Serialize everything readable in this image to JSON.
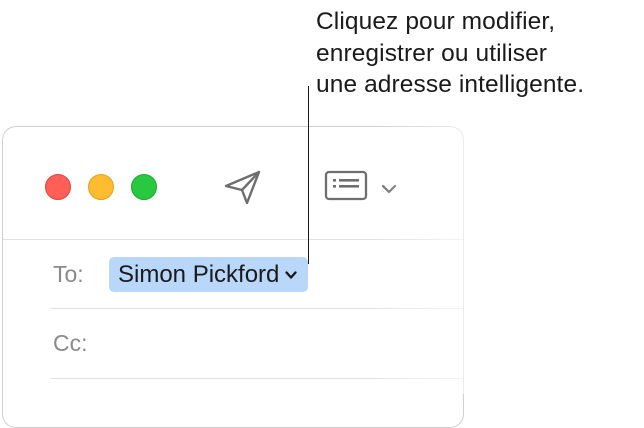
{
  "callout": {
    "lines": [
      "Cliquez pour modifier,",
      "enregistrer ou utiliser",
      "une adresse intelligente."
    ]
  },
  "window": {
    "toolbar": {
      "traffic_lights": [
        "close",
        "minimize",
        "zoom"
      ],
      "send_icon": "paper-plane-icon",
      "format_icon": "header-fields-icon",
      "format_menu_icon": "chevron-down-icon"
    },
    "fields": {
      "to_label": "To:",
      "to_recipient": "Simon Pickford",
      "cc_label": "Cc:"
    },
    "colors": {
      "token_background": "#b9d7fb",
      "close": "#ff5f57",
      "minimize": "#febc2e",
      "zoom": "#28c840"
    }
  }
}
